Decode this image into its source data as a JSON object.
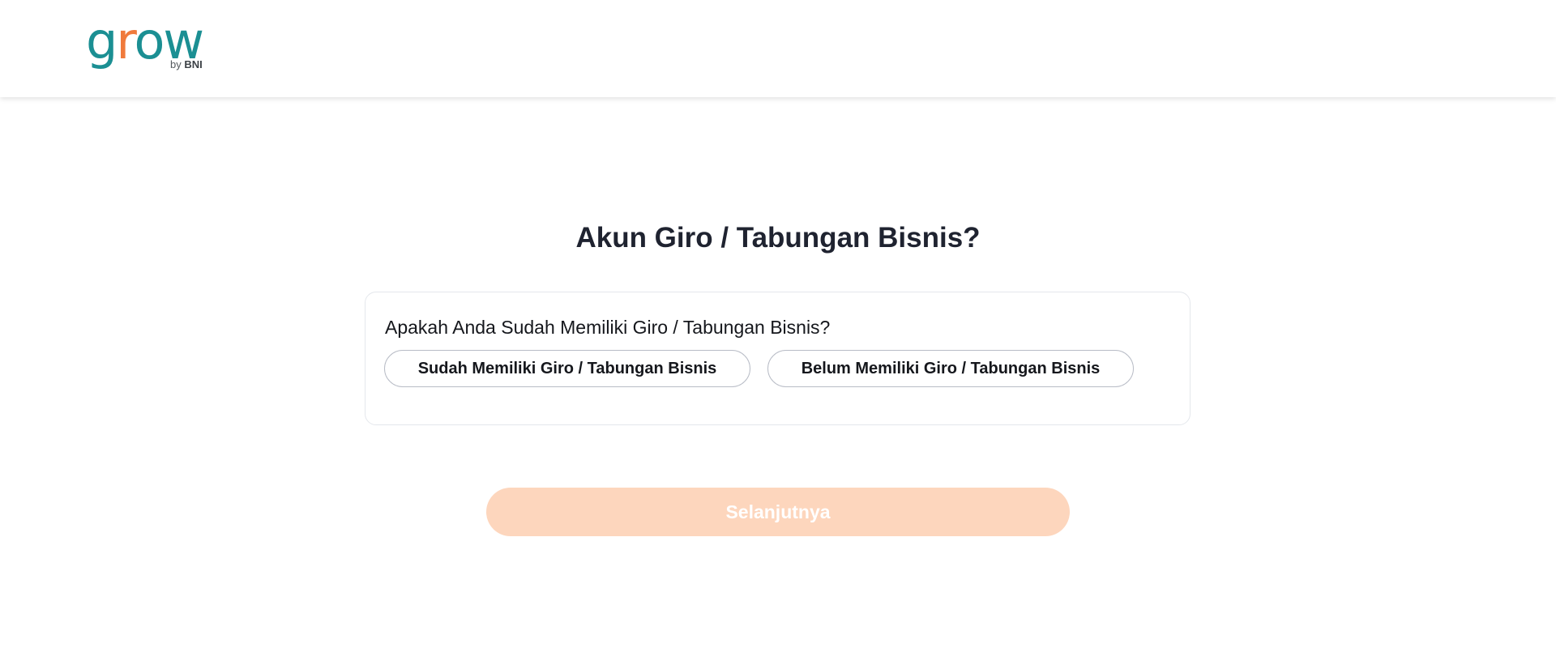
{
  "header": {
    "logo": {
      "word_prefix": "g",
      "word_accent": "r",
      "word_suffix": "ow",
      "sub_prefix": "by ",
      "sub_brand": "BNI",
      "brand_color": "#1b8f93",
      "accent_color": "#f07a3c"
    }
  },
  "main": {
    "title": "Akun Giro / Tabungan Bisnis?",
    "card": {
      "question": "Apakah Anda Sudah Memiliki Giro / Tabungan Bisnis?",
      "options": [
        {
          "label": "Sudah Memiliki Giro / Tabungan Bisnis",
          "selected": false
        },
        {
          "label": "Belum Memiliki Giro / Tabungan Bisnis",
          "selected": false
        }
      ]
    },
    "next_button": {
      "label": "Selanjutnya",
      "disabled": true,
      "color": "#fdd6bd"
    }
  }
}
